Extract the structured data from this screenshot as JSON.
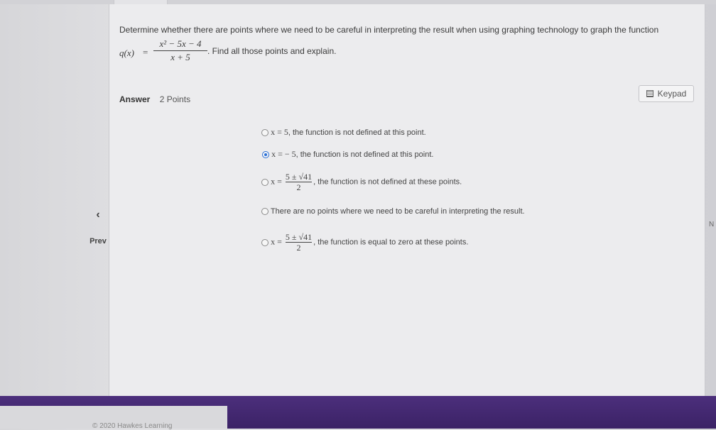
{
  "question": {
    "text_before": "Determine whether there are points where we need to be careful in interpreting the result when using graphing technology to graph the function",
    "function_name": "q(x)",
    "equals": "=",
    "numerator": "x² − 5x − 4",
    "denominator": "x + 5",
    "text_after": ". Find all those points and explain."
  },
  "answer": {
    "label": "Answer",
    "points": "2 Points"
  },
  "keypad": {
    "label": "Keypad",
    "icon": "keypad-icon"
  },
  "options": [
    {
      "math": "x = 5",
      "text": ", the function is not defined at this point.",
      "selected": false
    },
    {
      "math": "x =  − 5",
      "text": ", the function is not defined at this point.",
      "selected": true
    },
    {
      "math_prefix": "x =",
      "frac_num": "5 ± √41",
      "frac_den": "2",
      "text": ", the function is not defined at these points.",
      "selected": false
    },
    {
      "text": "There are no points where we need to be careful in interpreting the result.",
      "selected": false
    },
    {
      "math_prefix": "x =",
      "frac_num": "5 ± √41",
      "frac_den": "2",
      "text": ", the function is equal to zero at these points.",
      "selected": false
    }
  ],
  "nav": {
    "prev_icon": "chevron-left-icon",
    "prev_label": "Prev",
    "side_letter": "N"
  },
  "footer": {
    "copyright": "© 2020 Hawkes Learning",
    "band_color": "#4c2f7c"
  },
  "colors": {
    "radio_selected": "#2a6fd6"
  }
}
